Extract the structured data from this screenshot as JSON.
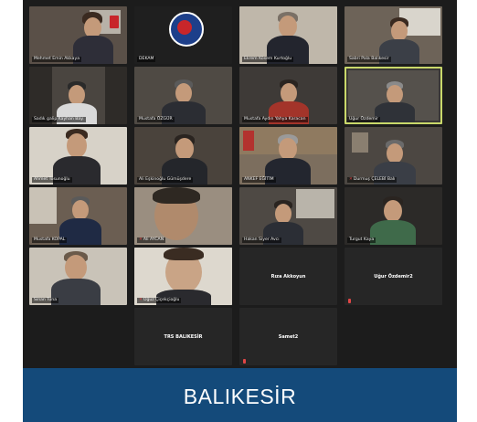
{
  "banner": {
    "title": "BALIKESİR"
  },
  "colors": {
    "banner_bg": "#144a7a",
    "active_border": "#c9d86a",
    "tile_bg": "#232323",
    "mute": "#e04646"
  },
  "participants": [
    {
      "name": "Mehmet Emin Akkaya",
      "kind": "video"
    },
    {
      "name": "DEKAM",
      "kind": "logo"
    },
    {
      "name": "Ekrem Kösem Kurtoğlu",
      "kind": "video"
    },
    {
      "name": "Sabri Pala Balıkesir",
      "kind": "video"
    },
    {
      "name": "Sadık galip Kayhan Bay.",
      "kind": "video"
    },
    {
      "name": "Mustafa ÖZGÜR",
      "kind": "video"
    },
    {
      "name": "Mustafa Aydın Yahya Karacan",
      "kind": "video"
    },
    {
      "name": "Uğur Özdemir",
      "kind": "video",
      "active": true
    },
    {
      "name": "Ahmet Tosunoğlu",
      "kind": "video"
    },
    {
      "name": "Ali Eşkinoğlu Gümüşdere",
      "kind": "video"
    },
    {
      "name": "ANKEF EĞİTİM",
      "kind": "video"
    },
    {
      "name": "Durmuş ÇELEBİ Balı",
      "kind": "video",
      "muted": true
    },
    {
      "name": "Mustafa KOPAL",
      "kind": "video"
    },
    {
      "name": "Ali AYCAN",
      "kind": "video",
      "muted": true
    },
    {
      "name": "Hakan Siyer Avcı",
      "kind": "video"
    },
    {
      "name": "Turgut Kaya",
      "kind": "video"
    },
    {
      "name": "Sinan Tuna",
      "kind": "video"
    },
    {
      "name": "Oğuz Çiçekçioğlu",
      "kind": "video",
      "muted": true
    },
    {
      "name": "Rıza Akkoyun",
      "kind": "name"
    },
    {
      "name": "Uğur Özdemir2",
      "kind": "name",
      "muted": true
    },
    {
      "name": "TRS BALIKESİR",
      "kind": "name"
    },
    {
      "name": "Samet2",
      "kind": "name",
      "muted": true
    }
  ]
}
